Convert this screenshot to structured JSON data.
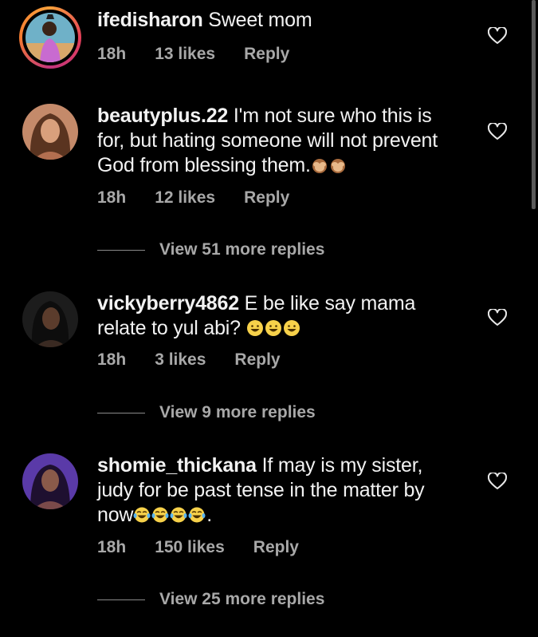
{
  "comments": [
    {
      "username": "ifedisharon",
      "text": "Sweet mom",
      "time": "18h",
      "likes": "13 likes",
      "reply": "Reply",
      "avatar": "woman-in-pink-avatar",
      "story_ring": true
    },
    {
      "username": "beautyplus.22",
      "text_line1": "I'm not sure who this is",
      "text_line2": "for, but hating someone will not prevent",
      "text_line3": "God from blessing them.",
      "emojis": [
        "see-no-evil-monkey",
        "see-no-evil-monkey"
      ],
      "time": "18h",
      "likes": "12 likes",
      "reply": "Reply",
      "view_replies": "View 51 more replies",
      "avatar": "woman-portrait-avatar"
    },
    {
      "username": "vickyberry4862",
      "text_line1": "E be like say mama",
      "text_line2": "relate to yul abi?",
      "emojis": [
        "grinning-face",
        "grinning-face",
        "grinning-face"
      ],
      "time": "18h",
      "likes": "3 likes",
      "reply": "Reply",
      "view_replies": "View 9 more replies",
      "avatar": "dark-portrait-avatar"
    },
    {
      "username": "shomie_thickana",
      "text_line1": "If may is my sister,",
      "text_line2": "judy for be past tense in the matter by",
      "text_line3_prefix": "now",
      "text_line3_suffix": ".",
      "emojis": [
        "tears-of-joy",
        "tears-of-joy",
        "tears-of-joy",
        "tears-of-joy"
      ],
      "time": "18h",
      "likes": "150 likes",
      "reply": "Reply",
      "view_replies": "View 25 more replies",
      "avatar": "purple-portrait-avatar"
    }
  ],
  "colors": {
    "background": "#000000",
    "text": "#f2f2f2",
    "meta": "#a8a8a8",
    "story_ring": "#e43f5a"
  }
}
